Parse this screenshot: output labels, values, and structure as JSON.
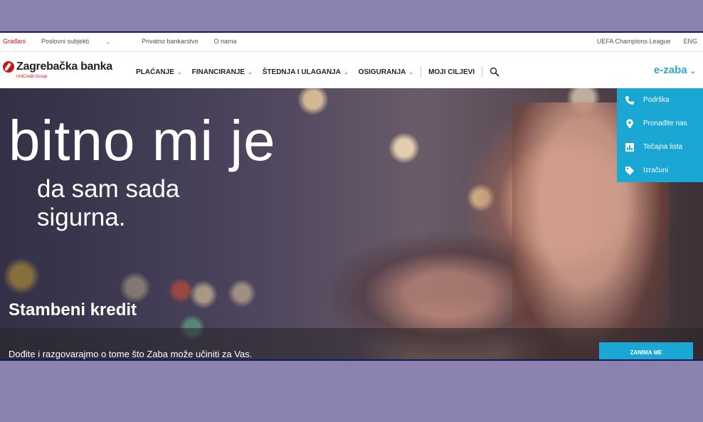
{
  "topbar": {
    "left": [
      {
        "label": "Građani",
        "active": true
      },
      {
        "label": "Poslovni subjekti",
        "dropdown": true
      },
      {
        "label": "Privatno bankarstvo"
      },
      {
        "label": "O nama"
      }
    ],
    "right": [
      "UEFA Champions League",
      "ENG"
    ]
  },
  "brand": {
    "name": "Zagrebačka banka",
    "sub": "UniCredit Group",
    "color": "#c4161c"
  },
  "nav": {
    "items": [
      {
        "label": "PLAĆANJE",
        "dropdown": true
      },
      {
        "label": "FINANCIRANJE",
        "dropdown": true
      },
      {
        "label": "ŠTEDNJA I ULAGANJA",
        "dropdown": true
      },
      {
        "label": "OSIGURANJA",
        "dropdown": true
      },
      {
        "label": "MOJI CILJEVI",
        "dropdown": false
      }
    ],
    "search_icon": "search-icon",
    "ezaba": "e-zaba",
    "accent": "#2aa9d2"
  },
  "side": [
    {
      "label": "Podrška",
      "icon": "phone-icon"
    },
    {
      "label": "Pronađite nas",
      "icon": "location-pin-icon"
    },
    {
      "label": "Tečajna lista",
      "icon": "chart-icon"
    },
    {
      "label": "Izračuni",
      "icon": "tag-icon"
    }
  ],
  "hero": {
    "headline": "bitno mi je",
    "line2": "da sam sada",
    "line3": "sigurna.",
    "product": "Stambeni kredit",
    "caption": "Dođite i razgovarajmo o tome što Zaba može učiniti za Vas.",
    "cta": "ZANIMA ME"
  }
}
